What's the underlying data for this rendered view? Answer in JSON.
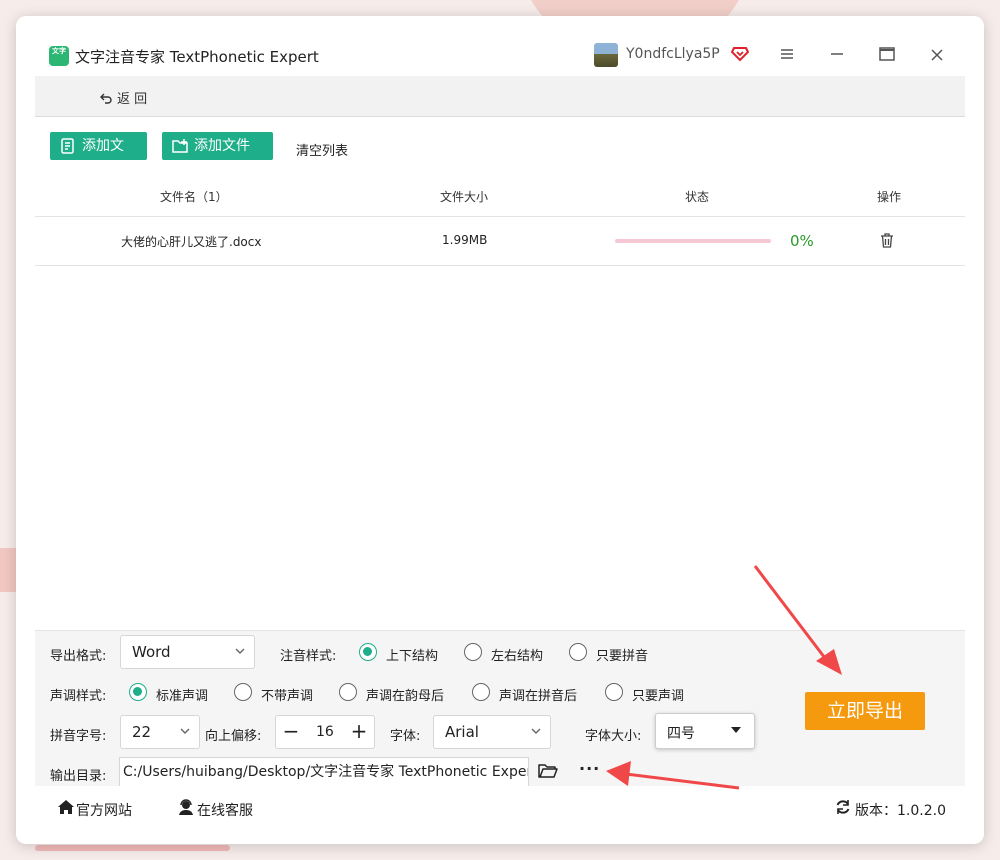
{
  "app": {
    "logo_text": "文字",
    "title": "文字注音专家 TextPhonetic Expert",
    "username": "Y0ndfcLlya5P"
  },
  "nav": {
    "back_label": "返 回"
  },
  "toolbar": {
    "add_file": "添加文件",
    "add_folder": "添加文件夹",
    "clear_list": "清空列表"
  },
  "table": {
    "headers": [
      "文件名（1）",
      "文件大小",
      "状态",
      "操作"
    ],
    "rows": [
      {
        "name": "大佬的心肝儿又逃了.docx",
        "size": "1.99MB",
        "progress": 0,
        "status_text": "0%"
      }
    ]
  },
  "settings": {
    "export_format_label": "导出格式:",
    "export_format_value": "Word",
    "phonetic_style_label": "注音样式:",
    "phonetic_style_options": [
      "上下结构",
      "左右结构",
      "只要拼音"
    ],
    "phonetic_style_selected": 0,
    "tone_style_label": "声调样式:",
    "tone_style_options": [
      "标准声调",
      "不带声调",
      "声调在韵母后",
      "声调在拼音后",
      "只要声调"
    ],
    "tone_style_selected": 0,
    "pinyin_size_label": "拼音字号:",
    "pinyin_size_value": "22",
    "offset_label": "向上偏移:",
    "offset_value": "16",
    "font_label": "字体:",
    "font_value": "Arial",
    "font_size_label": "字体大小:",
    "font_size_value": "四号",
    "output_dir_label": "输出目录:",
    "output_dir_value": "C:/Users/huibang/Desktop/文字注音专家 TextPhonetic Expert",
    "more_label": "···",
    "export_button": "立即导出"
  },
  "footer": {
    "website": "官方网站",
    "support": "在线客服",
    "version": "版本：1.0.2.0"
  },
  "colors": {
    "accent": "#1fae8a",
    "export": "#f59a0e",
    "progress": "#f6c8d4",
    "status_green": "#2a9a2a",
    "annotation_arrow": "#f04848"
  }
}
